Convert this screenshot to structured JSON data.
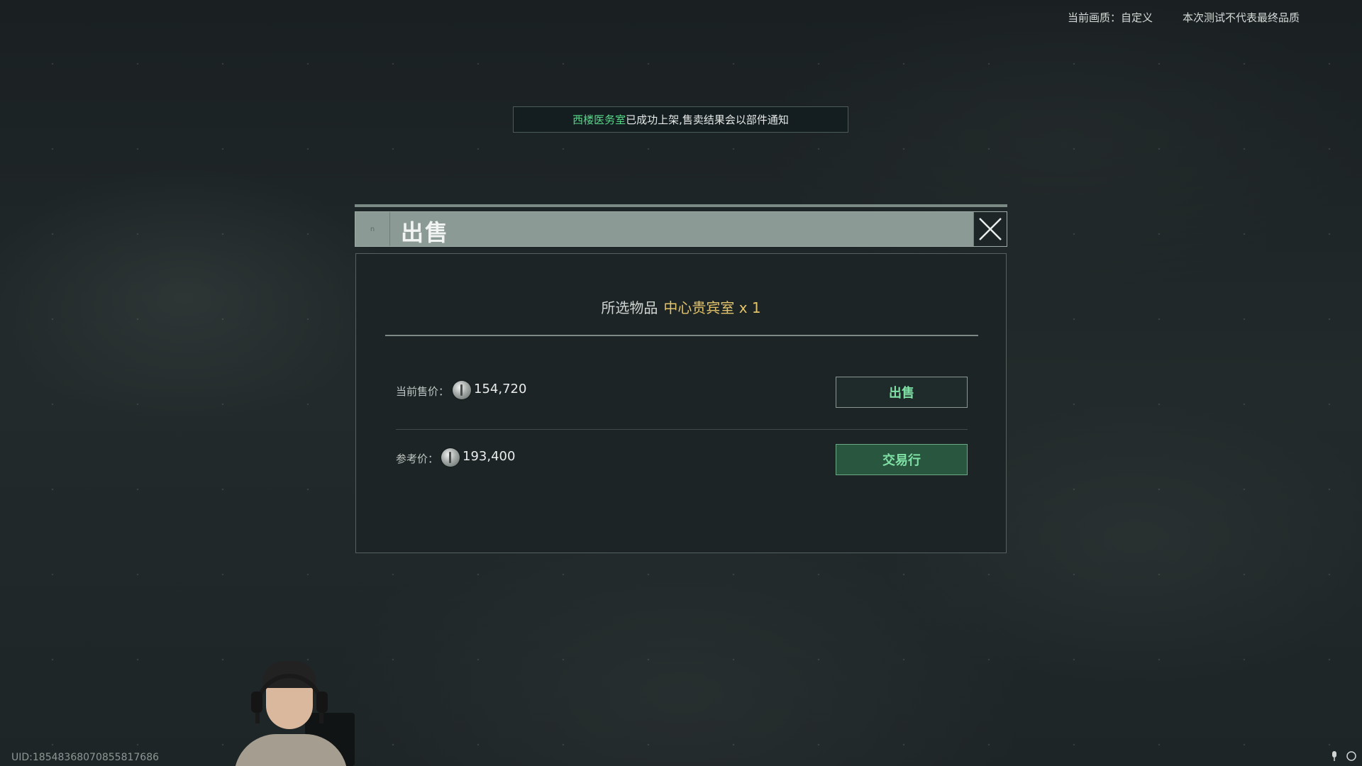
{
  "top_info": {
    "quality": "当前画质：自定义",
    "disclaimer": "本次测试不代表最终品质"
  },
  "toast": {
    "highlight": "西楼医务室",
    "message": "已成功上架,售卖结果会以部件通知"
  },
  "dialog": {
    "corner_mark": "n",
    "title": "出售",
    "selected_label": "所选物品",
    "item_name": "中心贵宾室 x 1",
    "current_price_label": "当前售价：",
    "current_price": "154,720",
    "sell_button": "出售",
    "reference_price_label": "参考价：",
    "reference_price": "193,400",
    "market_button": "交易行"
  },
  "footer": {
    "uid": "UID:185483680708558176​86"
  },
  "colors": {
    "accent_green": "#58d98a",
    "item_gold": "#e3c36a",
    "header_bg": "#8b9a95",
    "market_button_bg": "#28563f"
  },
  "icons": {
    "close": "close-icon",
    "coin": "coin-icon",
    "mic": "microphone-icon",
    "refresh": "refresh-icon"
  }
}
